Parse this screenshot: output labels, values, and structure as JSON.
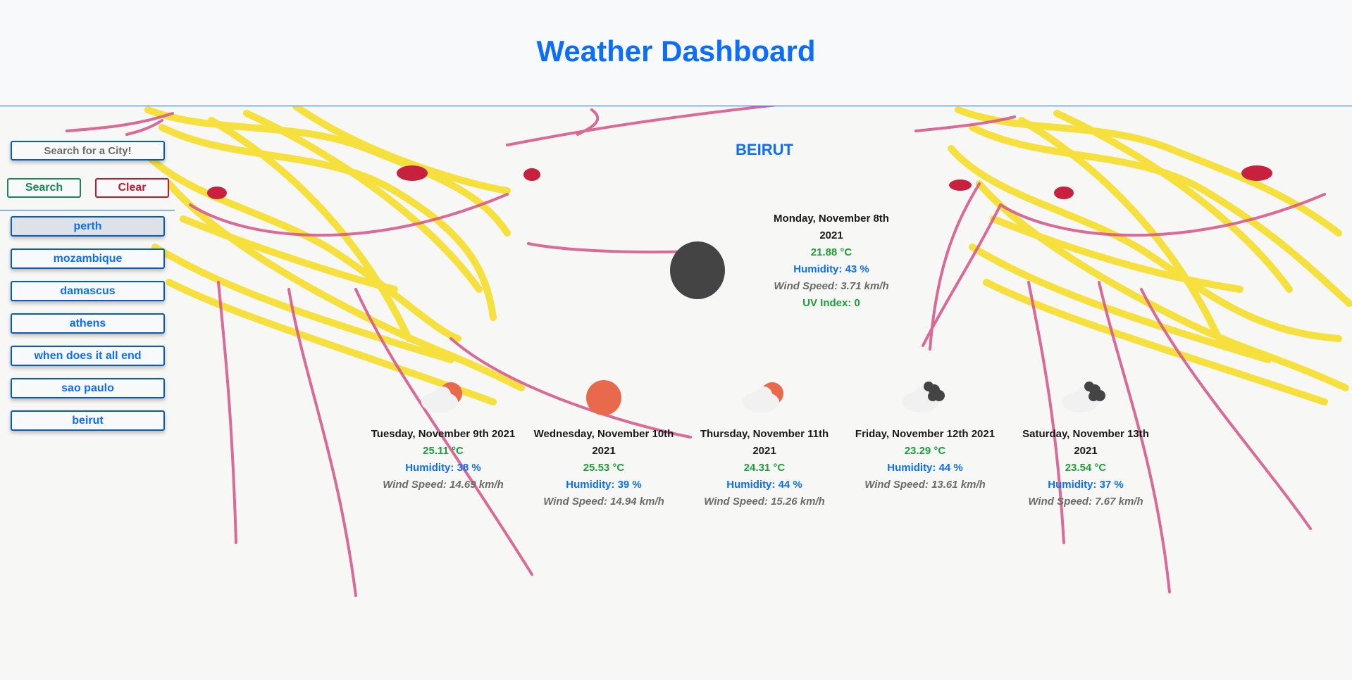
{
  "header": {
    "title": "Weather Dashboard"
  },
  "sidebar": {
    "search_placeholder": "Search for a City!",
    "search_label": "Search",
    "clear_label": "Clear",
    "cities": [
      "perth",
      "mozambique",
      "damascus",
      "athens",
      "when does it all end",
      "sao paulo",
      "beirut"
    ],
    "active_city": "perth"
  },
  "current": {
    "city": "BEIRUT",
    "date": "Monday, November 8th 2021",
    "temp": "21.88 °C",
    "humidity": "Humidity: 43 %",
    "wind": "Wind Speed: 3.71 km/h",
    "uv": "UV Index: 0",
    "icon": "night-clear-icon"
  },
  "forecast": [
    {
      "date": "Tuesday, November 9th 2021",
      "temp": "25.11 °C",
      "humidity": "Humidity: 38 %",
      "wind": "Wind Speed: 14.69 km/h",
      "icon": "partly-cloudy-icon"
    },
    {
      "date": "Wednesday, November 10th 2021",
      "temp": "25.53 °C",
      "humidity": "Humidity: 39 %",
      "wind": "Wind Speed: 14.94 km/h",
      "icon": "sun-icon"
    },
    {
      "date": "Thursday, November 11th 2021",
      "temp": "24.31 °C",
      "humidity": "Humidity: 44 %",
      "wind": "Wind Speed: 15.26 km/h",
      "icon": "partly-cloudy-icon"
    },
    {
      "date": "Friday, November 12th 2021",
      "temp": "23.29 °C",
      "humidity": "Humidity: 44 %",
      "wind": "Wind Speed: 13.61 km/h",
      "icon": "broken-clouds-icon"
    },
    {
      "date": "Saturday, November 13th 2021",
      "temp": "23.54 °C",
      "humidity": "Humidity: 37 %",
      "wind": "Wind Speed: 7.67 km/h",
      "icon": "broken-clouds-icon"
    }
  ],
  "colors": {
    "primary": "#0d6efd",
    "success": "#198754",
    "danger": "#c0182d",
    "sun": "#e9694d",
    "night": "#444444"
  }
}
